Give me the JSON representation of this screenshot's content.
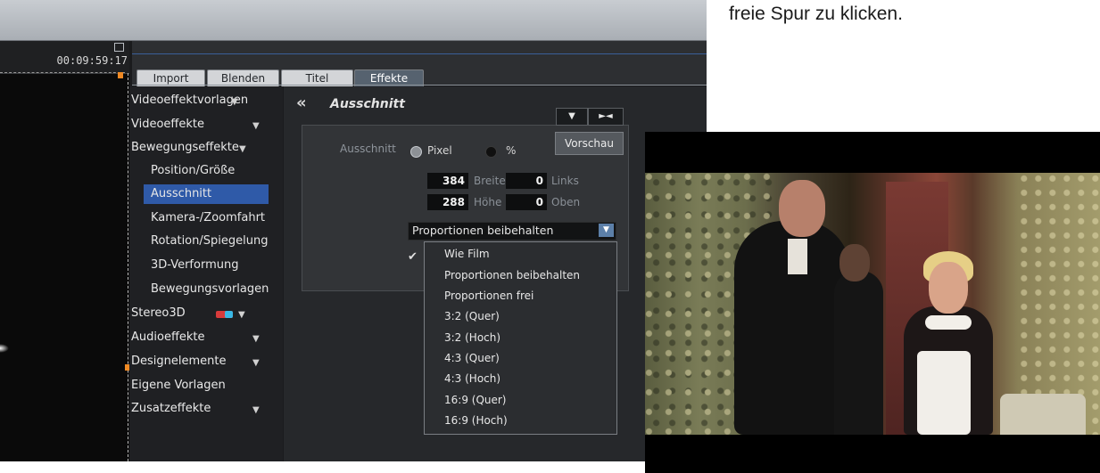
{
  "doc_text": "freie Spur zu klicken.",
  "timeline": {
    "timecode": "00:09:59:17"
  },
  "tabs": [
    {
      "label": "Import"
    },
    {
      "label": "Blenden"
    },
    {
      "label": "Titel"
    },
    {
      "label": "Effekte",
      "active": true
    }
  ],
  "categories": {
    "videoeffektvorlagen": "Videoeffektvorlagen",
    "videoeffekte": "Videoeffekte",
    "bewegungseffekte": "Bewegungseffekte",
    "sub_items": [
      "Position/Größe",
      "Ausschnitt",
      "Kamera-/Zoomfahrt",
      "Rotation/Spiegelung",
      "3D-Verformung",
      "Bewegungsvorlagen"
    ],
    "selected_sub": "Ausschnitt",
    "stereo3d": "Stereo3D",
    "audioeffekte": "Audioeffekte",
    "designelemente": "Designelemente",
    "eigene_vorlagen": "Eigene Vorlagen",
    "zusatzeffekte": "Zusatzeffekte"
  },
  "panel": {
    "back_symbol": "«",
    "title": "Ausschnitt",
    "ausschnitt_label": "Ausschnitt",
    "unit_pixel": "Pixel",
    "unit_percent": "%",
    "breite_value": "384",
    "breite_label": "Breite",
    "links_value": "0",
    "links_label": "Links",
    "hoehe_value": "288",
    "hoehe_label": "Höhe",
    "oben_value": "0",
    "oben_label": "Oben",
    "aspect_selected": "Proportionen beibehalten"
  },
  "controls": {
    "down_symbol": "▼",
    "collapse_symbol": "►◄",
    "preview_label": "Vorschau"
  },
  "dropdown_options": [
    "Wie Film",
    "Proportionen beibehalten",
    "Proportionen frei",
    "3:2 (Quer)",
    "3:2 (Hoch)",
    "4:3 (Quer)",
    "4:3 (Hoch)",
    "16:9 (Quer)",
    "16:9 (Hoch)"
  ],
  "colors": {
    "tab_active": "#56626f",
    "selection": "#2f5aa8",
    "dropdown_button": "#5c7fa8",
    "marker": "#f08a24"
  }
}
